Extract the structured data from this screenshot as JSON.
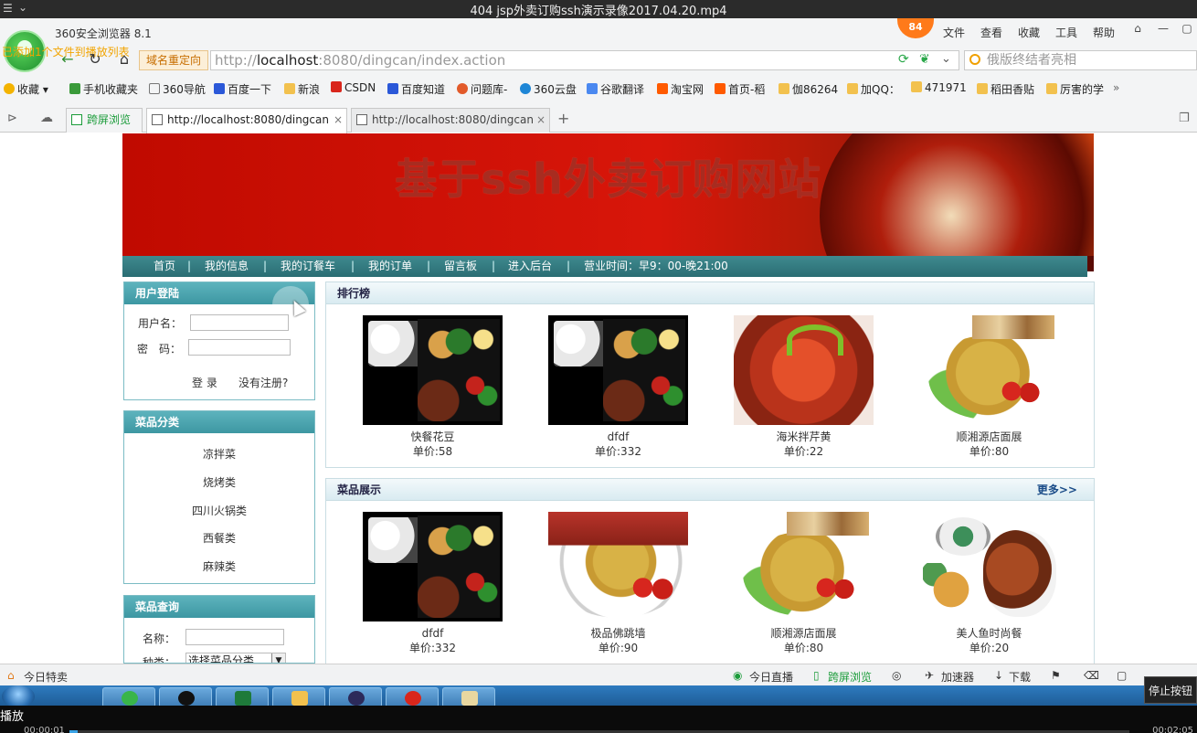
{
  "player": {
    "title": "404 jsp外卖订购ssh演示录像2017.04.20.mp4",
    "play_label": "播放",
    "time_current": "00:00:01",
    "time_total": "00:02:05",
    "progress_fraction": 0.008,
    "stop_label": "停止按钮"
  },
  "browser": {
    "name": "360安全浏览器 8.1",
    "overlay_note": "已添加1个文件到播放列表",
    "badge": "84",
    "menu": [
      "文件",
      "查看",
      "收藏",
      "工具",
      "帮助"
    ],
    "redirect_tag": "域名重定向",
    "url_prefix": "http://",
    "url_host": "localhost",
    "url_rest": ":8080/dingcan/index.action",
    "search_placeholder": "俄版终结者亮相",
    "bookmarks": [
      "收藏",
      "手机收藏夹",
      "360导航",
      "百度一下",
      "新浪",
      "CSDN",
      "百度知道",
      "问题库-",
      "360云盘",
      "谷歌翻译",
      "淘宝网",
      "首页-稻",
      "伽86264",
      "加QQ：",
      "471971",
      "稻田香贴",
      "厉害的学"
    ],
    "tabs": [
      {
        "label": "跨屏浏览"
      },
      {
        "label": "http://localhost:8080/dingcan"
      },
      {
        "label": "http://localhost:8080/dingcan"
      }
    ],
    "status_left": "今日特卖",
    "status_items": [
      "今日直播",
      "跨屏浏览",
      "加速器",
      "下载"
    ]
  },
  "site": {
    "banner_title": "基于ssh外卖订购网站",
    "nav": [
      "首页",
      "我的信息",
      "我的订餐车",
      "我的订单",
      "留言板",
      "进入后台",
      "营业时间：早9：00-晚21:00"
    ],
    "login": {
      "title": "用户登陆",
      "username_label": "用户名：",
      "password_label": "密　码：",
      "login_button": "登 录",
      "register_link": "没有注册?"
    },
    "categories": {
      "title": "菜品分类",
      "items": [
        "凉拌菜",
        "烧烤类",
        "四川火锅类",
        "西餐类",
        "麻辣类"
      ]
    },
    "query": {
      "title": "菜品查询",
      "name_label": "名称：",
      "type_label": "种类：",
      "type_selected": "选择菜品分类"
    },
    "ranking": {
      "title": "排行榜",
      "items": [
        {
          "name": "快餐花豆",
          "price": "单价:58",
          "img": "bento"
        },
        {
          "name": "dfdf",
          "price": "单价:332",
          "img": "bento"
        },
        {
          "name": "海米拌芹黄",
          "price": "单价:22",
          "img": "stew"
        },
        {
          "name": "顺湘源店面展",
          "price": "单价:80",
          "img": "rice"
        }
      ]
    },
    "showcase": {
      "title": "菜品展示",
      "more": "更多>>",
      "items": [
        {
          "name": "dfdf",
          "price": "单价:332",
          "img": "bento"
        },
        {
          "name": "极品佛跳墙",
          "price": "单价:90",
          "img": "rice2"
        },
        {
          "name": "顺湘源店面展",
          "price": "单价:80",
          "img": "rice"
        },
        {
          "name": "美人鱼时尚餐",
          "price": "单价:20",
          "img": "chicken"
        }
      ]
    }
  },
  "colors": {
    "banner_red": "#c00a00",
    "nav_teal": "#2a6d73",
    "box_head_teal": "#3d97a2",
    "more_link": "#1a4c88"
  }
}
